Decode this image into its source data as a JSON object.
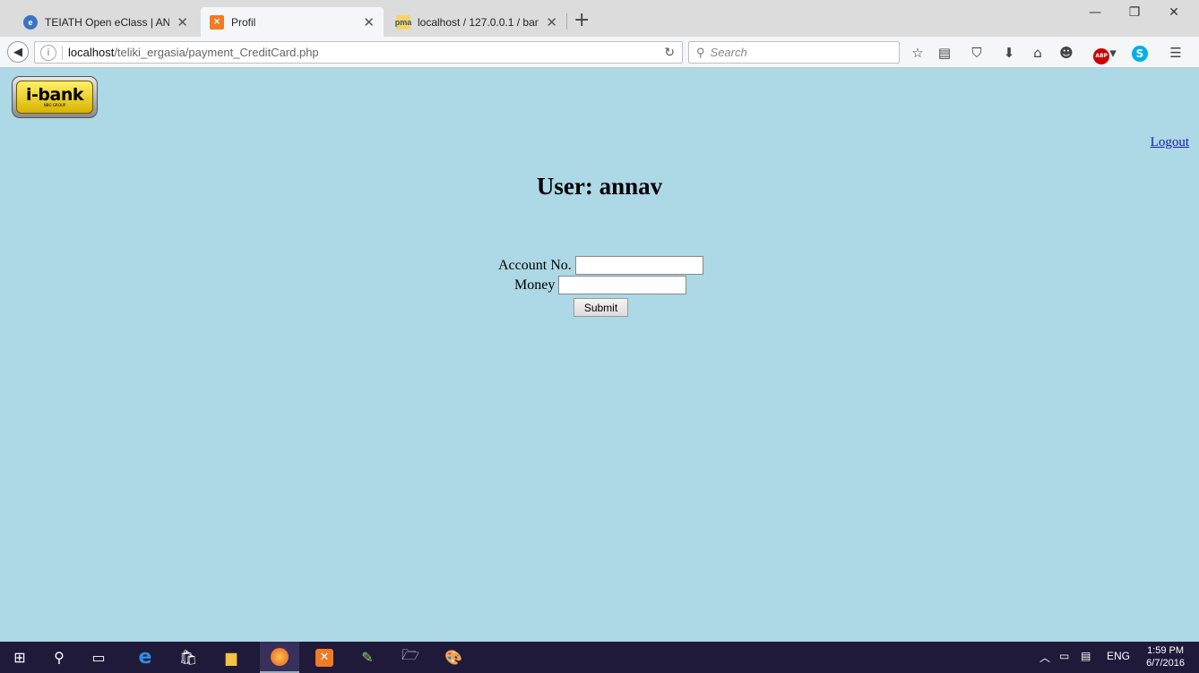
{
  "browser": {
    "tabs": [
      {
        "title": "TEIATH Open eClass | AN...",
        "active": false
      },
      {
        "title": "Profil",
        "active": true
      },
      {
        "title": "localhost / 127.0.0.1 / ban...",
        "active": false
      }
    ],
    "new_tab": "+",
    "url_host": "localhost",
    "url_path": "/teliki_ergasia/payment_CreditCard.php",
    "search_placeholder": "Search"
  },
  "page": {
    "logo_text": "i-bank",
    "logo_sub": "NBG GROUP",
    "logout_label": "Logout",
    "title": "User: annav",
    "account_label": "Account No.",
    "account_value": "",
    "money_label": "Money",
    "money_value": "",
    "submit_label": "Submit",
    "background_color": "#add8e6"
  },
  "taskbar": {
    "language": "ENG",
    "time": "1:59 PM",
    "date": "6/7/2016"
  }
}
